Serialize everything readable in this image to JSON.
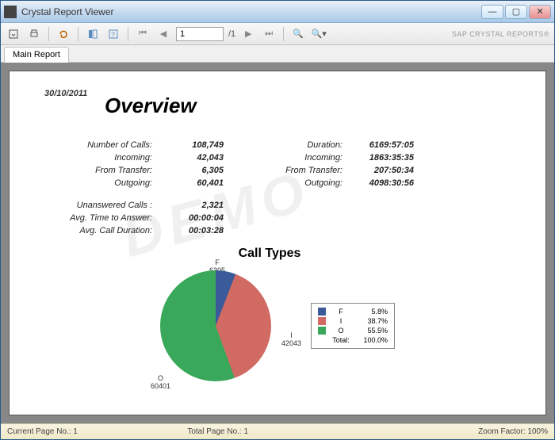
{
  "window": {
    "title": "Crystal Report Viewer",
    "brand": "SAP CRYSTAL REPORTS®"
  },
  "toolbar": {
    "page_value": "1",
    "page_total": "/1"
  },
  "tabs": {
    "main": "Main Report"
  },
  "report": {
    "date": "30/10/2011",
    "title": "Overview",
    "watermark": "DEMO",
    "left_col": [
      {
        "label": "Number of Calls:",
        "value": "108,749"
      },
      {
        "label": "Incoming:",
        "value": "42,043"
      },
      {
        "label": "From Transfer:",
        "value": "6,305"
      },
      {
        "label": "Outgoing:",
        "value": "60,401"
      }
    ],
    "right_col": [
      {
        "label": "Duration:",
        "value": "6169:57:05"
      },
      {
        "label": "Incoming:",
        "value": "1863:35:35"
      },
      {
        "label": "From Transfer:",
        "value": "207:50:34"
      },
      {
        "label": "Outgoing:",
        "value": "4098:30:56"
      }
    ],
    "bottom_col": [
      {
        "label": "Unanswered Calls :",
        "value": "2,321"
      },
      {
        "label": "Avg. Time to Answer:",
        "value": "00:00:04"
      },
      {
        "label": "Avg. Call Duration:",
        "value": "00:03:28"
      }
    ]
  },
  "chart_data": {
    "type": "pie",
    "title": "Call Types",
    "series": [
      {
        "name": "F",
        "value": 6305,
        "percent": "5.8%",
        "color": "#3a5a9a"
      },
      {
        "name": "I",
        "value": 42043,
        "percent": "38.7%",
        "color": "#d06a62"
      },
      {
        "name": "O",
        "value": 60401,
        "percent": "55.5%",
        "color": "#3aa85a"
      }
    ],
    "legend_total_label": "Total:",
    "legend_total_value": "100.0%"
  },
  "statusbar": {
    "current_page": "Current Page No.: 1",
    "total_page": "Total Page No.: 1",
    "zoom": "Zoom Factor: 100%"
  }
}
